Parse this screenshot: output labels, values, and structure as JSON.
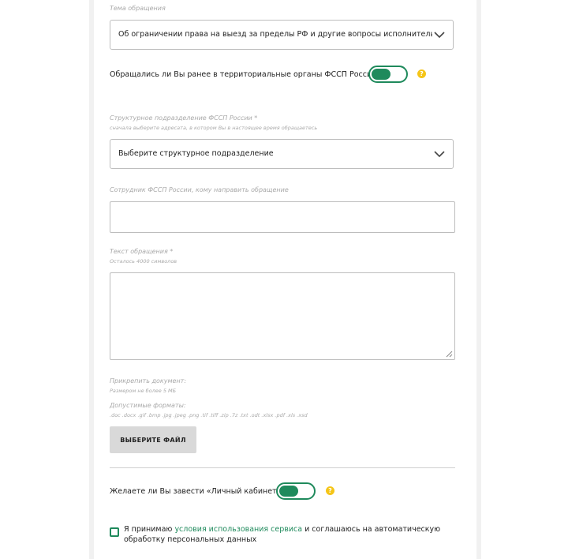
{
  "topic": {
    "label": "Тема обращения",
    "value": "Об ограничении права на выезд за пределы РФ и другие вопросы исполнительного п..."
  },
  "prior_contact": {
    "question": "Обращались ли Вы ранее в территориальные органы ФССП России:",
    "toggle_on": true
  },
  "division": {
    "label": "Структурное подразделение ФССП России *",
    "hint": "сначала выберите адресата, в котором Вы в настоящее время обращаетесь",
    "placeholder": "Выберите структурное подразделение"
  },
  "employee": {
    "label": "Сотрудник ФССП России, кому направить обращение"
  },
  "message": {
    "label": "Текст обращения *",
    "hint": "Осталось 4000 символов"
  },
  "attachment": {
    "label": "Прикрепить документ:",
    "size_hint": "Размером не более 5 МБ",
    "formats_label": "Допустимые форматы:",
    "formats": ".doc .docx .gif .bmp .jpg .jpeg .png .tif .tiff .zip .7z .txt .odt .xlsx .pdf .xls .xsd",
    "button_label": "ВЫБЕРИТЕ ФАЙЛ"
  },
  "cabinet": {
    "question": "Желаете ли Вы завести «Личный кабинет»:",
    "toggle_on": true
  },
  "consent": {
    "prefix": "Я принимаю ",
    "link": "условия использования сервиса",
    "suffix": " и соглашаюсь на автоматическую обработку персональных данных",
    "checked": false
  },
  "colors": {
    "accent": "#1f8a5c",
    "help": "#f5c518"
  }
}
